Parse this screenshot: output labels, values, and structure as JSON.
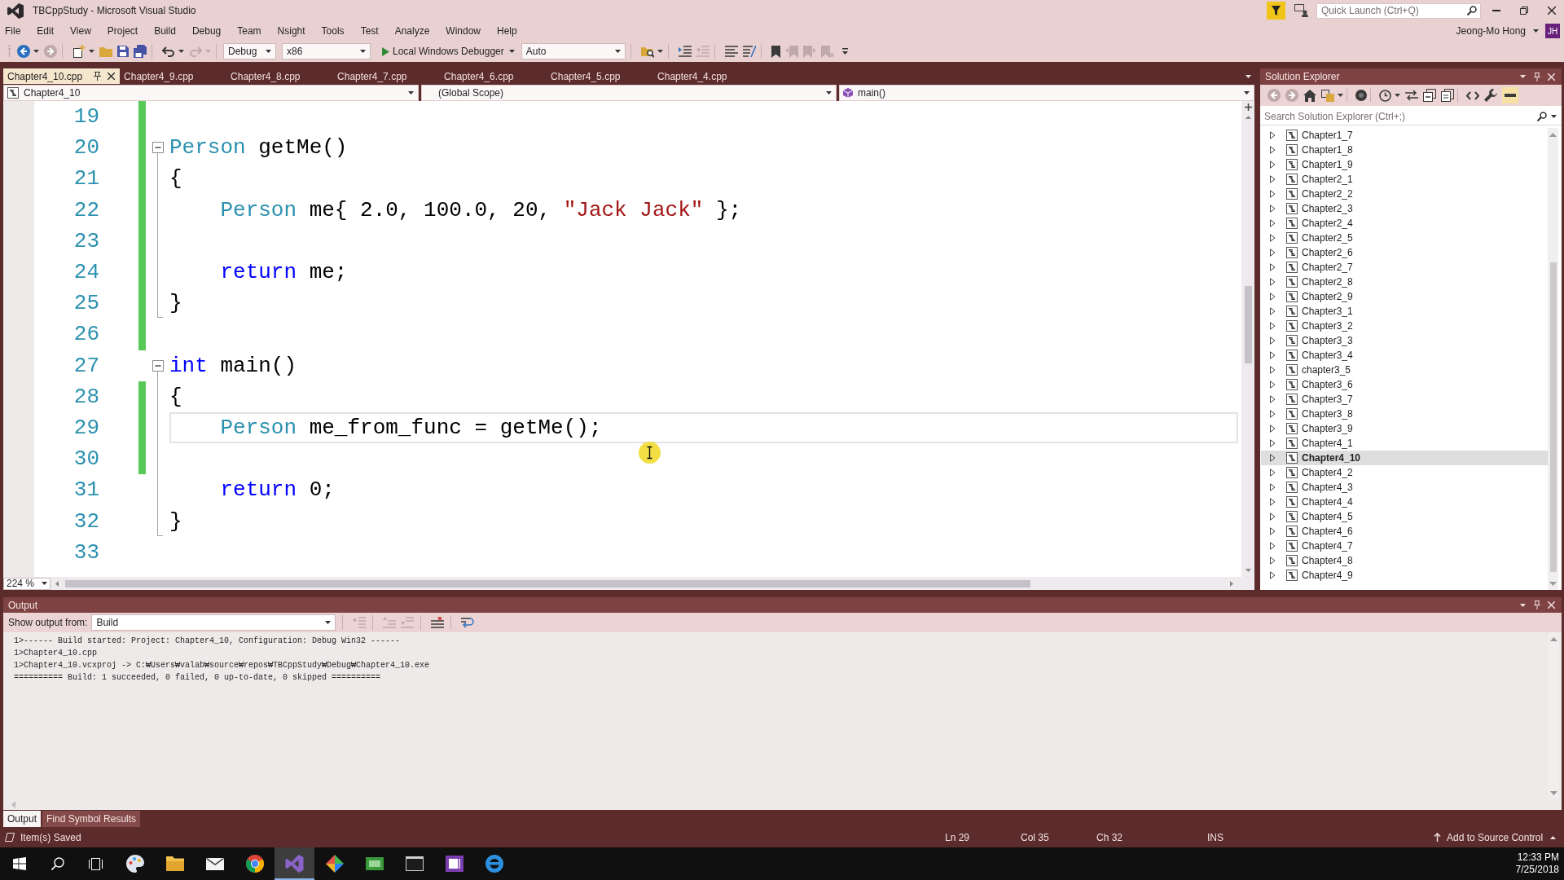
{
  "window": {
    "title": "TBCppStudy - Microsoft Visual Studio",
    "quick_launch": {
      "placeholder": "Quick Launch (Ctrl+Q)"
    },
    "user": {
      "name": "Jeong-Mo Hong",
      "initials": "JH"
    }
  },
  "menu": [
    "File",
    "Edit",
    "View",
    "Project",
    "Build",
    "Debug",
    "Team",
    "Nsight",
    "Tools",
    "Test",
    "Analyze",
    "Window",
    "Help"
  ],
  "toolbar": {
    "left_buttons": [
      {
        "disabled": false
      },
      {
        "disabled": true
      },
      {
        "disabled": false
      },
      {
        "disabled": false
      },
      {
        "disabled": false
      },
      {
        "disabled": false
      },
      {
        "disabled": false
      },
      {
        "disabled": true
      }
    ],
    "configuration": "Debug",
    "platform": "x86",
    "start": "Local Windows Debugger",
    "target": "Auto",
    "right_buttons": [
      {
        "disabled": false
      },
      {
        "disabled": false
      },
      {
        "disabled": true
      },
      {
        "disabled": false
      },
      {
        "disabled": false
      },
      {
        "disabled": false
      },
      {
        "disabled": true
      },
      {
        "disabled": true
      },
      {
        "disabled": true
      }
    ]
  },
  "tabs": [
    {
      "label": "Chapter4_10.cpp",
      "selected": true
    },
    {
      "label": "Chapter4_9.cpp",
      "selected": false
    },
    {
      "label": "Chapter4_8.cpp",
      "selected": false
    },
    {
      "label": "Chapter4_7.cpp",
      "selected": false
    },
    {
      "label": "Chapter4_6.cpp",
      "selected": false
    },
    {
      "label": "Chapter4_5.cpp",
      "selected": false
    },
    {
      "label": "Chapter4_4.cpp",
      "selected": false
    }
  ],
  "navigation": {
    "project": "Chapter4_10",
    "scope": "(Global Scope)",
    "member": "main()"
  },
  "editor": {
    "zoom": "224 %",
    "lines": [
      {
        "number": "19",
        "kind": "plain",
        "changed": true,
        "current": false
      },
      {
        "number": "20",
        "kind": "fold",
        "expanded": true,
        "changed": true,
        "current": false,
        "tokens": [
          {
            "kind": "type",
            "text": "Person"
          },
          {
            "kind": "plain",
            "text": " getMe()"
          }
        ]
      },
      {
        "number": "21",
        "kind": "inner",
        "changed": true,
        "current": false,
        "tokens": [
          {
            "kind": "plain",
            "text": "{"
          }
        ]
      },
      {
        "number": "22",
        "kind": "inner",
        "changed": true,
        "current": false,
        "tokens": [
          {
            "kind": "type",
            "text": "    Person"
          },
          {
            "kind": "plain",
            "text": " me{ 2.0, 100.0, 20, "
          },
          {
            "kind": "string",
            "text": "\"Jack Jack\""
          },
          {
            "kind": "plain",
            "text": " };"
          }
        ]
      },
      {
        "number": "23",
        "kind": "inner",
        "changed": true,
        "current": false
      },
      {
        "number": "24",
        "kind": "inner",
        "changed": true,
        "current": false,
        "tokens": [
          {
            "kind": "keyword",
            "text": "    return"
          },
          {
            "kind": "plain",
            "text": " me;"
          }
        ]
      },
      {
        "number": "25",
        "kind": "last",
        "changed": true,
        "current": false,
        "tokens": [
          {
            "kind": "plain",
            "text": "}"
          }
        ]
      },
      {
        "number": "26",
        "kind": "plain",
        "changed": true,
        "current": false
      },
      {
        "number": "27",
        "kind": "fold",
        "expanded": true,
        "changed": false,
        "current": false,
        "tokens": [
          {
            "kind": "keyword",
            "text": "int"
          },
          {
            "kind": "plain",
            "text": " main()"
          }
        ]
      },
      {
        "number": "28",
        "kind": "inner",
        "changed": true,
        "current": false,
        "tokens": [
          {
            "kind": "plain",
            "text": "{"
          }
        ]
      },
      {
        "number": "29",
        "kind": "inner",
        "changed": true,
        "current": true,
        "tokens": [
          {
            "kind": "type",
            "text": "    Person"
          },
          {
            "kind": "plain",
            "text": " me_from_func = getMe();"
          }
        ]
      },
      {
        "number": "30",
        "kind": "inner",
        "changed": true,
        "current": false
      },
      {
        "number": "31",
        "kind": "inner",
        "changed": false,
        "current": false,
        "tokens": [
          {
            "kind": "keyword",
            "text": "    return"
          },
          {
            "kind": "plain",
            "text": " 0;"
          }
        ]
      },
      {
        "number": "32",
        "kind": "last",
        "changed": false,
        "current": false,
        "tokens": [
          {
            "kind": "plain",
            "text": "}"
          }
        ]
      },
      {
        "number": "33",
        "kind": "plain",
        "changed": false,
        "current": false
      }
    ]
  },
  "solution_explorer": {
    "title": "Solution Explorer",
    "toolbar": [
      {
        "disabled": true,
        "on": false
      },
      {
        "disabled": true,
        "on": false
      },
      {
        "disabled": false,
        "on": false
      },
      {
        "disabled": false,
        "on": false
      },
      {
        "disabled": false,
        "on": false
      },
      {
        "disabled": false,
        "on": false
      },
      {
        "disabled": false,
        "on": false
      },
      {
        "disabled": false,
        "on": false
      },
      {
        "disabled": false,
        "on": false
      },
      {
        "disabled": false,
        "on": false
      },
      {
        "disabled": false,
        "on": false
      },
      {
        "disabled": false,
        "on": true
      }
    ],
    "search": {
      "placeholder": "Search Solution Explorer (Ctrl+;)"
    },
    "items": [
      {
        "label": "Chapter1_7",
        "expanded": false,
        "selected": false
      },
      {
        "label": "Chapter1_8",
        "expanded": false,
        "selected": false
      },
      {
        "label": "Chapter1_9",
        "expanded": false,
        "selected": false
      },
      {
        "label": "Chapter2_1",
        "expanded": false,
        "selected": false
      },
      {
        "label": "Chapter2_2",
        "expanded": false,
        "selected": false
      },
      {
        "label": "Chapter2_3",
        "expanded": false,
        "selected": false
      },
      {
        "label": "Chapter2_4",
        "expanded": false,
        "selected": false
      },
      {
        "label": "Chapter2_5",
        "expanded": false,
        "selected": false
      },
      {
        "label": "Chapter2_6",
        "expanded": false,
        "selected": false
      },
      {
        "label": "Chapter2_7",
        "expanded": false,
        "selected": false
      },
      {
        "label": "Chapter2_8",
        "expanded": false,
        "selected": false
      },
      {
        "label": "Chapter2_9",
        "expanded": false,
        "selected": false
      },
      {
        "label": "Chapter3_1",
        "expanded": false,
        "selected": false
      },
      {
        "label": "Chapter3_2",
        "expanded": false,
        "selected": false
      },
      {
        "label": "Chapter3_3",
        "expanded": false,
        "selected": false
      },
      {
        "label": "Chapter3_4",
        "expanded": false,
        "selected": false
      },
      {
        "label": "chapter3_5",
        "expanded": false,
        "selected": false
      },
      {
        "label": "Chapter3_6",
        "expanded": false,
        "selected": false
      },
      {
        "label": "Chapter3_7",
        "expanded": false,
        "selected": false
      },
      {
        "label": "Chapter3_8",
        "expanded": false,
        "selected": false
      },
      {
        "label": "Chapter3_9",
        "expanded": false,
        "selected": false
      },
      {
        "label": "Chapter4_1",
        "expanded": false,
        "selected": false
      },
      {
        "label": "Chapter4_10",
        "expanded": false,
        "selected": true
      },
      {
        "label": "Chapter4_2",
        "expanded": false,
        "selected": false
      },
      {
        "label": "Chapter4_3",
        "expanded": false,
        "selected": false
      },
      {
        "label": "Chapter4_4",
        "expanded": false,
        "selected": false
      },
      {
        "label": "Chapter4_5",
        "expanded": false,
        "selected": false
      },
      {
        "label": "Chapter4_6",
        "expanded": false,
        "selected": false
      },
      {
        "label": "Chapter4_7",
        "expanded": false,
        "selected": false
      },
      {
        "label": "Chapter4_8",
        "expanded": false,
        "selected": false
      },
      {
        "label": "Chapter4_9",
        "expanded": false,
        "selected": false
      }
    ]
  },
  "output": {
    "title": "Output",
    "source_label": "Show output from:",
    "source": "Build",
    "toolbar": [
      {
        "disabled": true
      },
      {
        "disabled": true
      },
      {
        "disabled": true
      },
      {
        "disabled": false
      },
      {
        "disabled": false
      }
    ],
    "lines": [
      "1>------ Build started: Project: Chapter4_10, Configuration: Debug Win32 ------",
      "1>Chapter4_10.cpp",
      "1>Chapter4_10.vcxproj -> C:₩Users₩valab₩source₩repos₩TBCppStudy₩Debug₩Chapter4_10.exe",
      "========== Build: 1 succeeded, 0 failed, 0 up-to-date, 0 skipped =========="
    ],
    "tabs": [
      {
        "label": "Output",
        "selected": true
      },
      {
        "label": "Find Symbol Results",
        "selected": false
      }
    ]
  },
  "status_bar": {
    "message": "Item(s) Saved",
    "line": "Ln 29",
    "column": "Col 35",
    "char": "Ch 32",
    "mode": "INS",
    "source_control": "Add to Source Control"
  },
  "taskbar": {
    "apps": [
      {
        "selected": false
      },
      {
        "selected": false
      },
      {
        "selected": false
      },
      {
        "selected": false
      },
      {
        "selected": true
      },
      {
        "selected": false
      },
      {
        "selected": false
      },
      {
        "selected": false
      },
      {
        "selected": false
      },
      {
        "selected": false
      }
    ],
    "time": "12:33 PM",
    "date": "7/25/2018"
  }
}
